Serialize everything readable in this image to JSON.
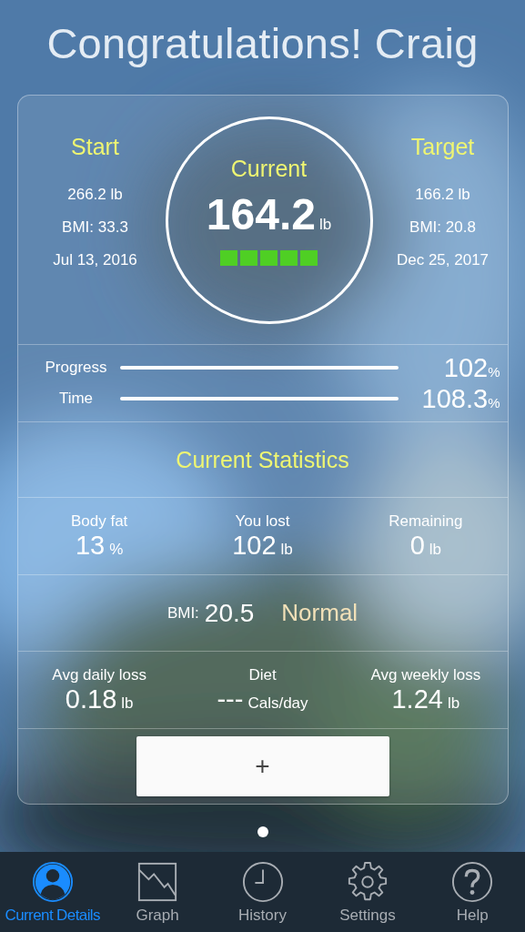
{
  "title": "Congratulations! Craig",
  "summary": {
    "start": {
      "label": "Start",
      "weight": "266.2 lb",
      "bmi": "BMI: 33.3",
      "date": "Jul 13, 2016"
    },
    "current": {
      "label": "Current",
      "value": "164.2",
      "unit": "lb",
      "stars": 5
    },
    "target": {
      "label": "Target",
      "weight": "166.2 lb",
      "bmi": "BMI: 20.8",
      "date": "Dec 25, 2017"
    }
  },
  "progress": [
    {
      "label": "Progress",
      "value": "102",
      "unit": "%"
    },
    {
      "label": "Time",
      "value": "108.3",
      "unit": "%"
    }
  ],
  "statistics_title": "Current Statistics",
  "stats": [
    {
      "label": "Body fat",
      "value": "13",
      "unit": "%"
    },
    {
      "label": "You lost",
      "value": "102",
      "unit": "lb"
    },
    {
      "label": "Remaining",
      "value": "0",
      "unit": "lb"
    }
  ],
  "bmi": {
    "label": "BMI:",
    "value": "20.5",
    "category": "Normal"
  },
  "averages": [
    {
      "label": "Avg daily loss",
      "value": "0.18",
      "unit": "lb"
    },
    {
      "label": "Diet",
      "value": "---",
      "unit": "Cals/day"
    },
    {
      "label": "Avg weekly loss",
      "value": "1.24",
      "unit": "lb"
    }
  ],
  "add_button": "+",
  "page_dots": [
    {
      "selected": true
    }
  ],
  "tabs": [
    {
      "label": "Current Details",
      "kind": "person",
      "selected": true
    },
    {
      "label": "Graph",
      "kind": "graph",
      "selected": false
    },
    {
      "label": "History",
      "kind": "clock",
      "selected": false
    },
    {
      "label": "Settings",
      "kind": "gear",
      "selected": false
    },
    {
      "label": "Help",
      "kind": "help",
      "selected": false
    }
  ]
}
